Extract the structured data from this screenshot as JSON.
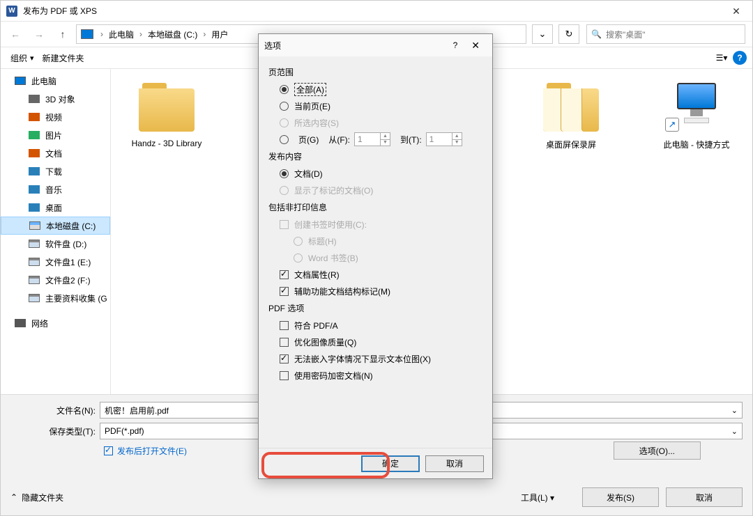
{
  "window": {
    "title": "发布为 PDF 或 XPS"
  },
  "breadcrumb": {
    "items": [
      "此电脑",
      "本地磁盘 (C:)",
      "用户"
    ],
    "drop_hint": ""
  },
  "search": {
    "placeholder": "搜索\"桌面\""
  },
  "toolbar": {
    "organize": "组织",
    "new_folder": "新建文件夹"
  },
  "sidebar": {
    "items": [
      {
        "label": "此电脑",
        "level": 1,
        "icon": "ic-pc"
      },
      {
        "label": "3D 对象",
        "level": 2,
        "icon": "ic-3d"
      },
      {
        "label": "视频",
        "level": 2,
        "icon": "ic-video"
      },
      {
        "label": "图片",
        "level": 2,
        "icon": "ic-img"
      },
      {
        "label": "文档",
        "level": 2,
        "icon": "ic-doc"
      },
      {
        "label": "下载",
        "level": 2,
        "icon": "ic-dl"
      },
      {
        "label": "音乐",
        "level": 2,
        "icon": "ic-music"
      },
      {
        "label": "桌面",
        "level": 2,
        "icon": "ic-desk"
      },
      {
        "label": "本地磁盘 (C:)",
        "level": 2,
        "icon": "ic-cdrive",
        "selected": true
      },
      {
        "label": "软件盘 (D:)",
        "level": 2,
        "icon": "ic-disk"
      },
      {
        "label": "文件盘1 (E:)",
        "level": 2,
        "icon": "ic-disk"
      },
      {
        "label": "文件盘2 (F:)",
        "level": 2,
        "icon": "ic-disk"
      },
      {
        "label": "主要资料收集 (G",
        "level": 2,
        "icon": "ic-disk"
      },
      {
        "label": "网络",
        "level": 1,
        "icon": "ic-net"
      }
    ]
  },
  "files": {
    "item1": "Handz - 3D Library",
    "item2": "桌面屏保录屏",
    "item3": "此电脑 - 快捷方式"
  },
  "bottom": {
    "filename_label": "文件名(N):",
    "filename_value": "机密！启用前.pdf",
    "save_type_label": "保存类型(T):",
    "save_type_value": "PDF(*.pdf)",
    "open_after": "发布后打开文件(E)",
    "options_btn": "选项(O)...",
    "hide_folders": "隐藏文件夹",
    "tools": "工具(L)",
    "publish": "发布(S)",
    "cancel": "取消"
  },
  "options": {
    "title": "选项",
    "page_range_title": "页范围",
    "all": "全部(A)",
    "current": "当前页(E)",
    "selection": "所选内容(S)",
    "pages_label": "页(G)",
    "from_label": "从(F):",
    "to_label": "到(T):",
    "from_val": "1",
    "to_val": "1",
    "publish_title": "发布内容",
    "doc": "文档(D)",
    "doc_marked": "显示了标记的文档(O)",
    "nonprint_title": "包括非打印信息",
    "bookmarks": "创建书签时使用(C):",
    "headings": "标题(H)",
    "word_bookmarks": "Word 书签(B)",
    "doc_properties": "文档属性(R)",
    "doc_structure": "辅助功能文档结构标记(M)",
    "pdf_options_title": "PDF 选项",
    "pdfa": "符合 PDF/A",
    "optimize_image": "优化图像质量(Q)",
    "bitmap_text": "无法嵌入字体情况下显示文本位图(X)",
    "encrypt": "使用密码加密文档(N)",
    "ok": "确定",
    "cancel": "取消"
  }
}
